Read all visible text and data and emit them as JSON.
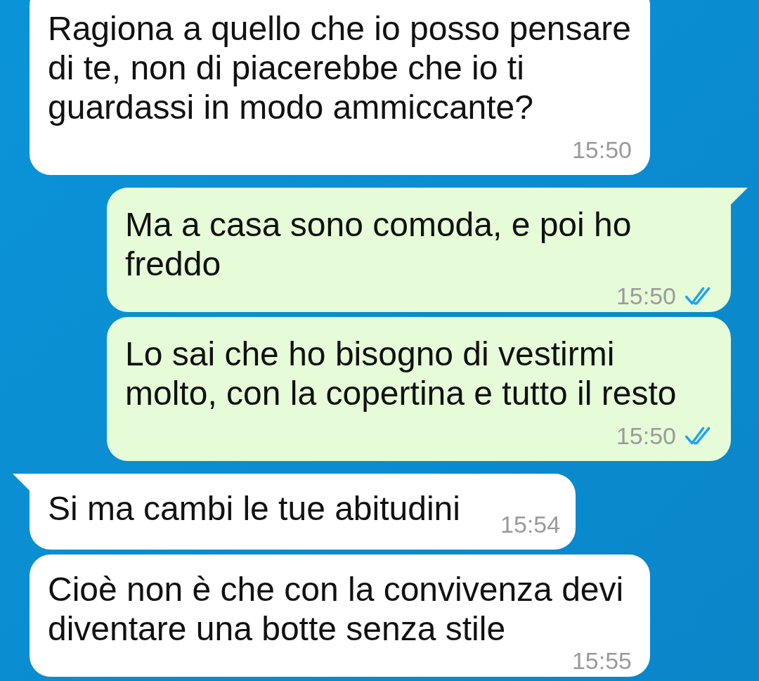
{
  "messages": [
    {
      "kind": "incoming",
      "tail": false,
      "text": "Ragiona a quello che io posso pensare di te, non di piacerebbe che io ti guardassi in modo ammiccante?",
      "time": "15:50"
    },
    {
      "kind": "outgoing",
      "tail": true,
      "text": "Ma a casa sono comoda, e poi ho freddo",
      "time": "15:50",
      "read": true
    },
    {
      "kind": "outgoing",
      "tail": false,
      "text": "Lo sai che ho bisogno di vestirmi molto, con la copertina e tutto il resto",
      "time": "15:50",
      "read": true
    },
    {
      "kind": "incoming",
      "tail": true,
      "text": "Si ma cambi le tue abitudini",
      "time": "15:54"
    },
    {
      "kind": "incoming",
      "tail": false,
      "text": "Cioè non è che con la convivenza devi diventare una botte senza stile",
      "time": "15:55"
    }
  ]
}
